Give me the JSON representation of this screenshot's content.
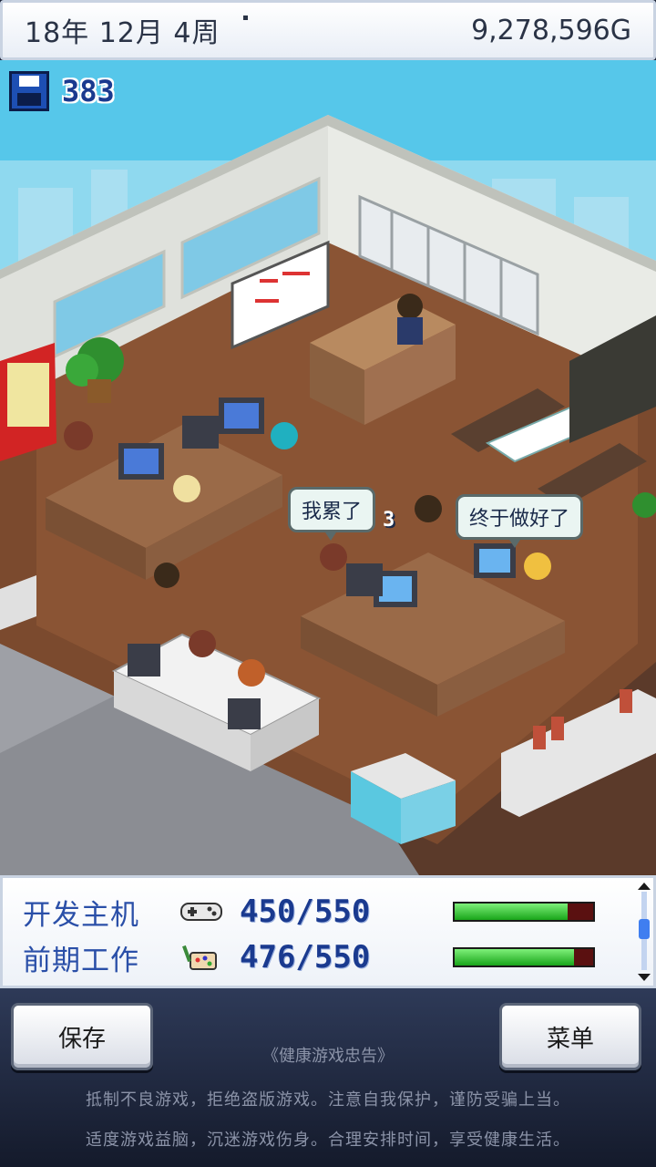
{
  "status_bar": {
    "date": "18年 12月 4周",
    "money": "9,278,596G"
  },
  "save_counter": {
    "icon": "floppy-disk-icon",
    "value": "383"
  },
  "bubbles": [
    {
      "text": "我累了"
    },
    {
      "text": "3"
    },
    {
      "text": "终于做好了"
    }
  ],
  "progress": [
    {
      "label": "开发主机",
      "icon": "gamepad-icon",
      "value": "450/550",
      "fraction": 0.818
    },
    {
      "label": "前期工作",
      "icon": "palette-brush-icon",
      "value": "476/550",
      "fraction": 0.865
    }
  ],
  "buttons": {
    "save": "保存",
    "menu": "菜单"
  },
  "notice": {
    "title": "《健康游戏忠告》",
    "line1": "抵制不良游戏，拒绝盗版游戏。注意自我保护，谨防受骗上当。",
    "line2": "适度游戏益脑，沉迷游戏伤身。合理安排时间，享受健康生活。"
  },
  "colors": {
    "accent": "#2a4fa8",
    "bar_fill": "#19a51a",
    "bar_empty": "#5a1010",
    "sky": "#4cc3e6"
  }
}
